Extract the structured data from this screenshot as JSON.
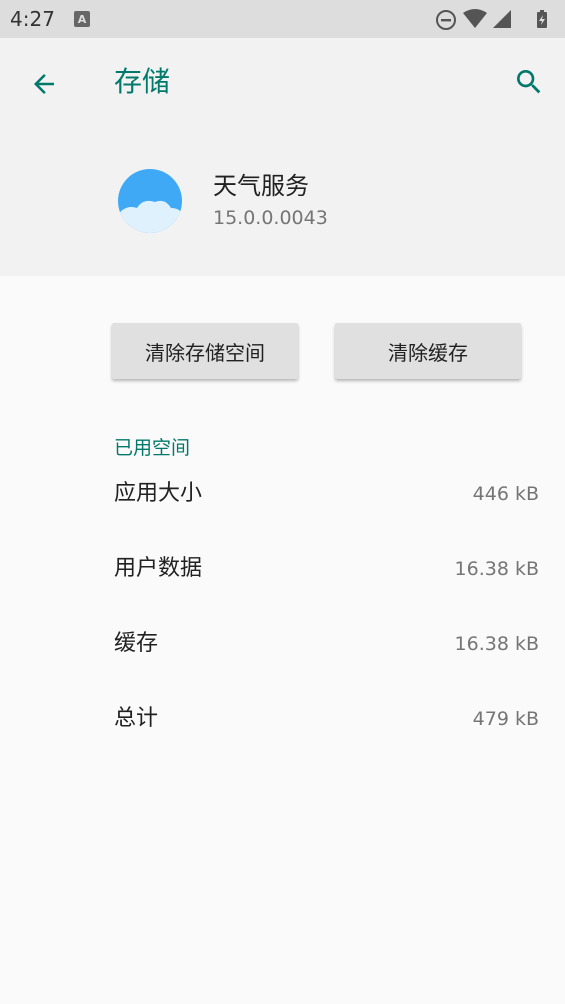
{
  "status_bar": {
    "time": "4:27",
    "notification_icon": "a-notification-icon",
    "icons": [
      "do-not-disturb-icon",
      "wifi-icon",
      "signal-icon",
      "battery-icon"
    ]
  },
  "header": {
    "title": "存储",
    "back_icon": "arrow-back-icon",
    "search_icon": "search-icon"
  },
  "app": {
    "name": "天气服务",
    "version": "15.0.0.0043"
  },
  "buttons": {
    "clear_storage": "清除存储空间",
    "clear_cache": "清除缓存"
  },
  "storage": {
    "section_title": "已用空间",
    "rows": [
      {
        "label": "应用大小",
        "value": "446 kB"
      },
      {
        "label": "用户数据",
        "value": "16.38 kB"
      },
      {
        "label": "缓存",
        "value": "16.38 kB"
      },
      {
        "label": "总计",
        "value": "479 kB"
      }
    ]
  },
  "colors": {
    "accent": "#00796b",
    "icon_blue": "#3fa9f5"
  }
}
